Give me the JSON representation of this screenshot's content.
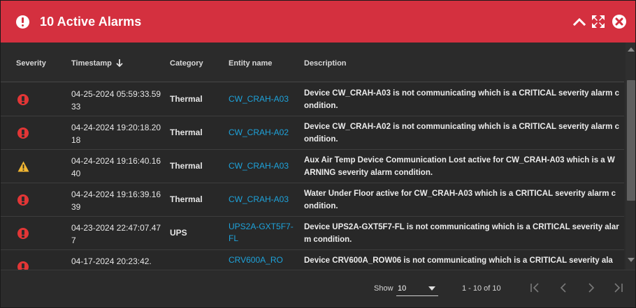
{
  "header": {
    "title": "10 Active Alarms",
    "accent_color": "#d4303f",
    "icons": [
      "alert-icon",
      "chevron-up-icon",
      "expand-icon",
      "close-icon"
    ]
  },
  "table": {
    "columns": {
      "severity": "Severity",
      "timestamp": "Timestamp",
      "category": "Category",
      "entity": "Entity name",
      "description": "Description"
    },
    "sort_icon": "arrow-down-icon",
    "rows": [
      {
        "severity": "critical",
        "timestamp": "04-25-2024 05:59:33.5933",
        "category": "Thermal",
        "entity": "CW_CRAH-A03",
        "description": "Device CW_CRAH-A03 is not communicating which is a CRITICAL severity alarm condition."
      },
      {
        "severity": "critical",
        "timestamp": "04-24-2024 19:20:18.2018",
        "category": "Thermal",
        "entity": "CW_CRAH-A02",
        "description": "Device CW_CRAH-A02 is not communicating which is a CRITICAL severity alarm condition."
      },
      {
        "severity": "warning",
        "timestamp": "04-24-2024 19:16:40.1640",
        "category": "Thermal",
        "entity": "CW_CRAH-A03",
        "description": "Aux Air Temp Device Communication Lost active for CW_CRAH-A03 which is a WARNING severity alarm condition."
      },
      {
        "severity": "critical",
        "timestamp": "04-24-2024 19:16:39.1639",
        "category": "Thermal",
        "entity": "CW_CRAH-A03",
        "description": "Water Under Floor active for CW_CRAH-A03 which is a CRITICAL severity alarm condition."
      },
      {
        "severity": "critical",
        "timestamp": "04-23-2024 22:47:07.477",
        "category": "UPS",
        "entity": "UPS2A-GXT5F7-FL",
        "description": "Device UPS2A-GXT5F7-FL is not communicating which is a CRITICAL severity alarm condition."
      },
      {
        "severity": "critical",
        "timestamp": "04-17-2024 20:23:42.",
        "category": "",
        "entity": "CRV600A_RO",
        "description": "Device CRV600A_ROW06 is not communicating which is a CRITICAL severity ala"
      }
    ]
  },
  "footer": {
    "show_label": "Show",
    "page_size": "10",
    "range": "1 - 10 of 10"
  },
  "colors": {
    "critical": "#e23636",
    "warning": "#f2b632",
    "link": "#1ea3db"
  }
}
